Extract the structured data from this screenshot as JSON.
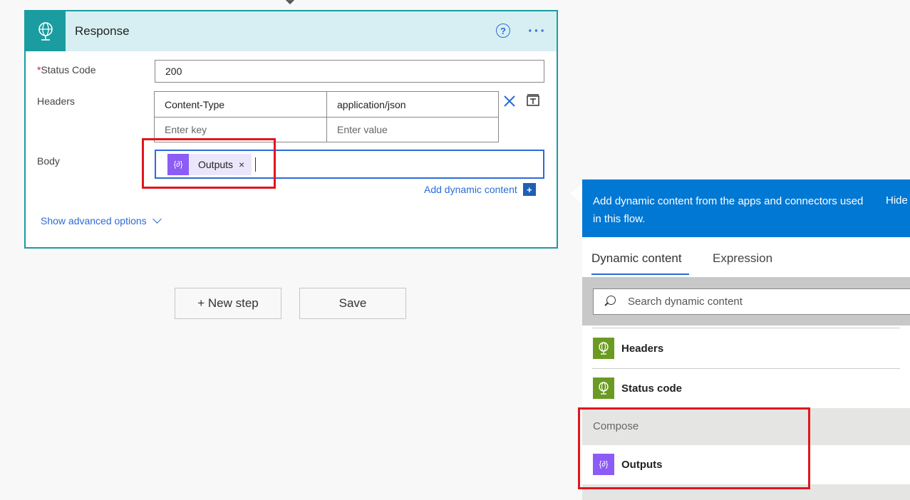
{
  "response_card": {
    "title": "Response",
    "status_code_label": "Status Code",
    "status_code_value": "200",
    "headers_label": "Headers",
    "header_rows": [
      {
        "key": "Content-Type",
        "value": "application/json"
      }
    ],
    "header_key_placeholder": "Enter key",
    "header_value_placeholder": "Enter value",
    "body_label": "Body",
    "body_token_label": "Outputs",
    "body_token_close": "×",
    "add_dynamic_label": "Add dynamic content",
    "show_advanced_label": "Show advanced options",
    "help_icon_glyph": "?",
    "more_icon_glyph": "···"
  },
  "buttons": {
    "new_step": "+ New step",
    "save": "Save"
  },
  "dynamic_panel": {
    "header_text": "Add dynamic content from the apps and connectors used in this flow.",
    "hide_label": "Hide",
    "tabs": [
      "Dynamic content",
      "Expression"
    ],
    "search_placeholder": "Search dynamic content",
    "items": [
      {
        "label": "Headers",
        "icon": "globe-icon"
      },
      {
        "label": "Status code",
        "icon": "globe-icon"
      }
    ],
    "group": {
      "label": "Compose",
      "items": [
        {
          "label": "Outputs",
          "icon": "compose-icon"
        }
      ]
    }
  },
  "colors": {
    "accent_teal": "#1a9ca1",
    "link_blue": "#2b6bd6",
    "panel_blue": "#0078d4",
    "compose_purple": "#8b5cf6",
    "request_green": "#6b9a23",
    "highlight_red": "#e0161f"
  }
}
